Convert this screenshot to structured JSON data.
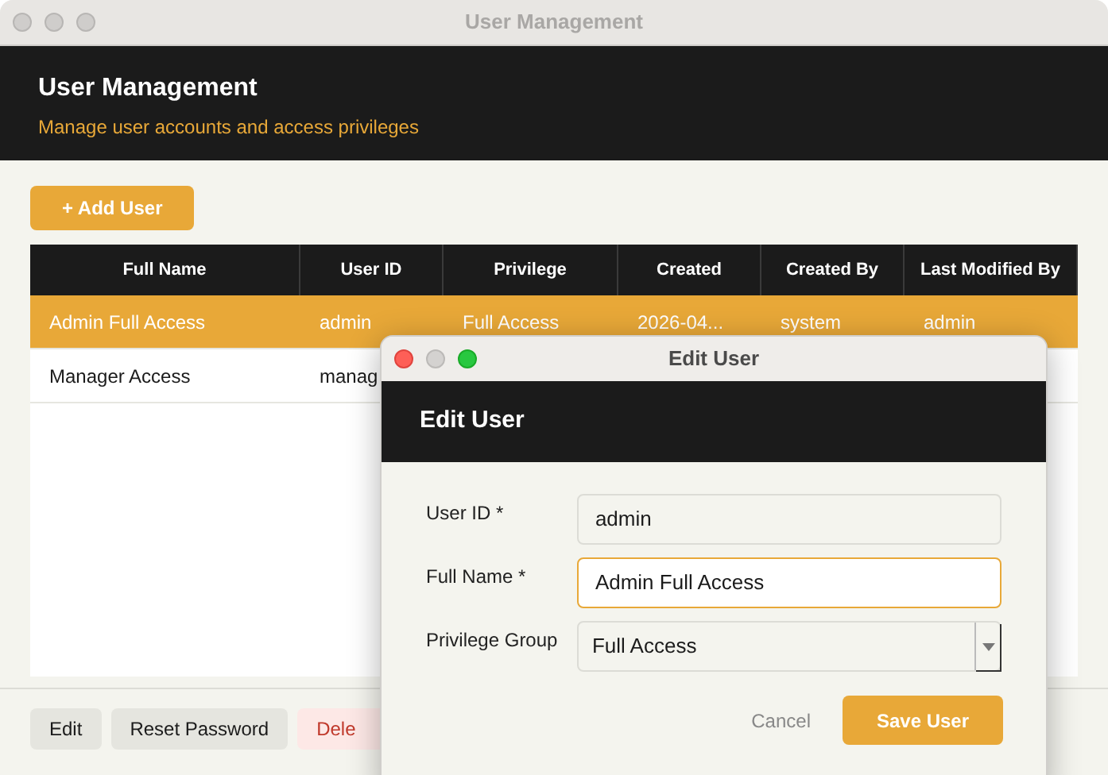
{
  "window": {
    "title": "User Management"
  },
  "header": {
    "title": "User Management",
    "subtitle": "Manage user accounts and access privileges"
  },
  "add_button": "+ Add User",
  "table": {
    "columns": [
      "Full Name",
      "User ID",
      "Privilege",
      "Created",
      "Created By",
      "Last Modified By"
    ],
    "rows": [
      {
        "cells": [
          "Admin Full Access",
          "admin",
          "Full Access",
          "2026-04...",
          "system",
          "admin"
        ],
        "selected": true
      },
      {
        "cells": [
          "Manager Access",
          "manag"
        ],
        "selected": false
      }
    ]
  },
  "footer_buttons": [
    {
      "label": "Edit",
      "kind": "plain"
    },
    {
      "label": "Reset Password",
      "kind": "plain"
    },
    {
      "label": "Dele",
      "kind": "danger"
    }
  ],
  "dialog": {
    "window_title": "Edit User",
    "title": "Edit User",
    "fields": [
      {
        "label": "User ID *",
        "value": "admin",
        "kind": "text",
        "focused": false
      },
      {
        "label": "Full Name *",
        "value": "Admin Full Access",
        "kind": "text",
        "focused": true
      },
      {
        "label": "Privilege Group",
        "value": "Full Access",
        "kind": "select",
        "focused": false
      }
    ],
    "cancel": "Cancel",
    "save": "Save User"
  }
}
